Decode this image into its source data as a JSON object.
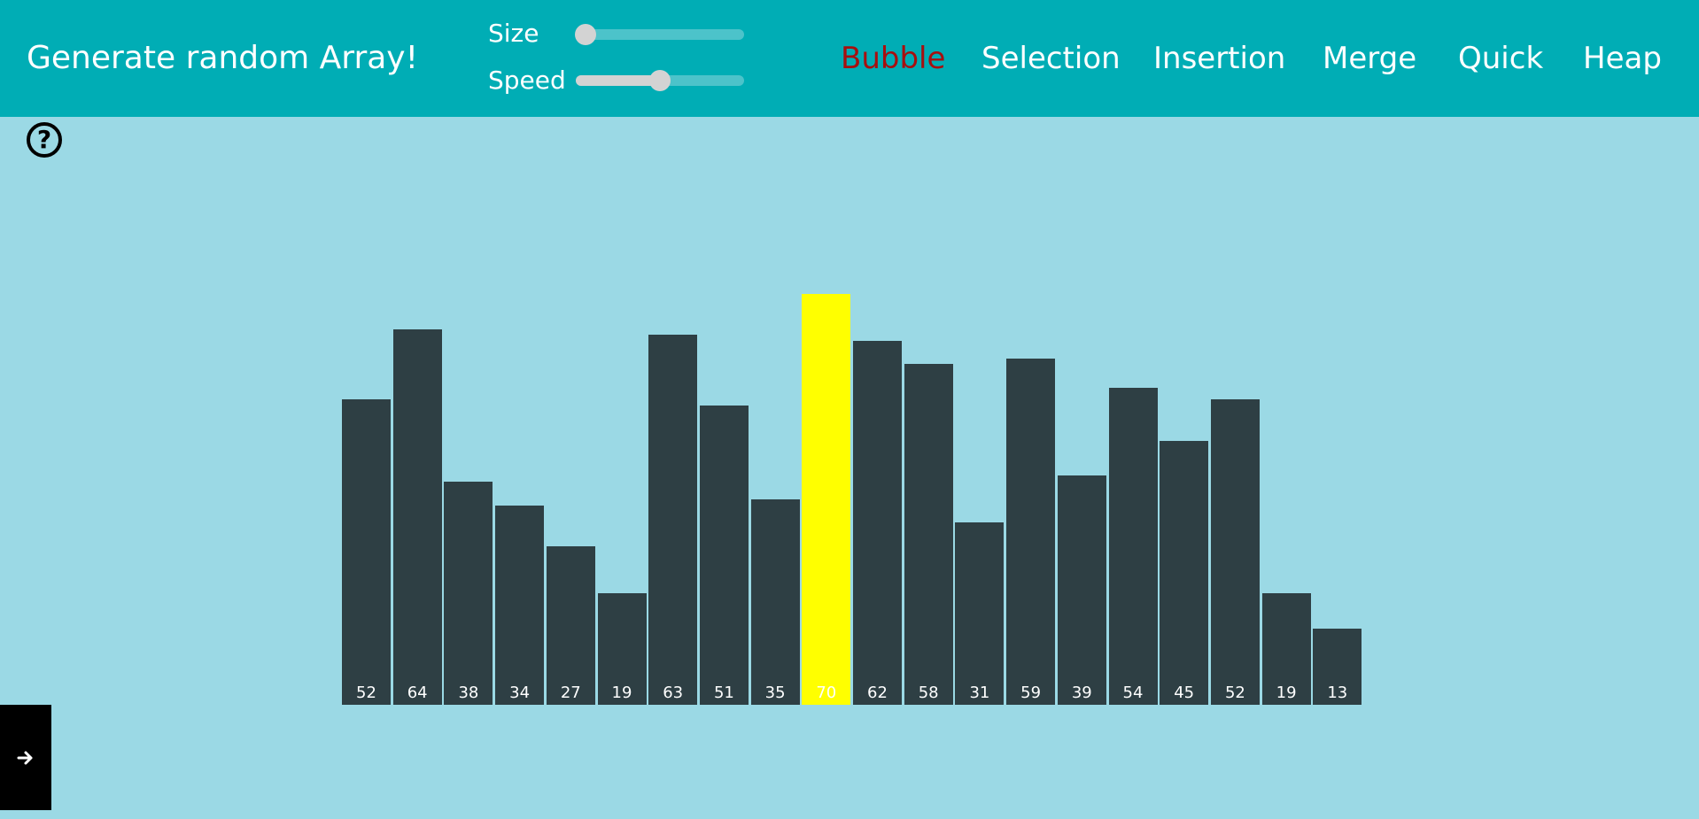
{
  "header": {
    "title": "Generate random Array!",
    "size_label": "Size",
    "speed_label": "Speed",
    "size_value": 0.06,
    "speed_value": 0.5
  },
  "algorithms": [
    {
      "label": "Bubble",
      "active": true
    },
    {
      "label": "Selection",
      "active": false
    },
    {
      "label": "Insertion",
      "active": false
    },
    {
      "label": "Merge",
      "active": false
    },
    {
      "label": "Quick",
      "active": false
    },
    {
      "label": "Heap",
      "active": false
    }
  ],
  "colors": {
    "header_bg": "#00adb5",
    "page_bg": "#9bd9e5",
    "bar": "#2e3f44",
    "highlight": "#ffff00",
    "active_algo": "#a70f0f"
  },
  "chart_data": {
    "type": "bar",
    "values": [
      52,
      64,
      38,
      34,
      27,
      19,
      63,
      51,
      35,
      70,
      62,
      58,
      31,
      59,
      39,
      54,
      45,
      52,
      19,
      13
    ],
    "highlighted_index": 9
  },
  "icons": {
    "help": "question-circle-icon",
    "side": "arrow-right-icon"
  }
}
